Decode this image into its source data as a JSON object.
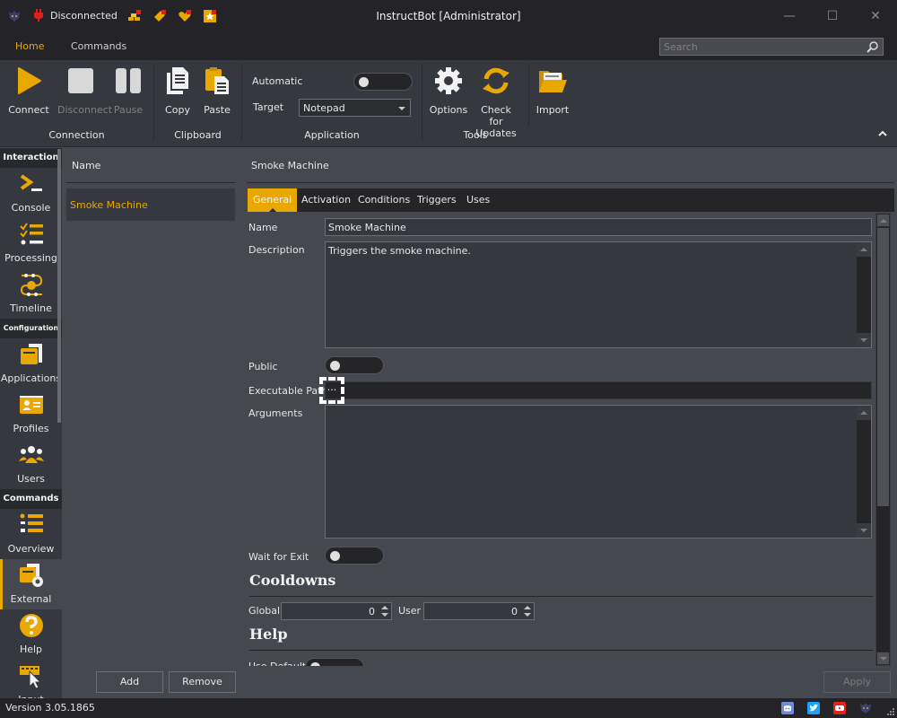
{
  "titlebar": {
    "connection_status": "Disconnected",
    "title": "InstructBot [Administrator]",
    "quick_icons": [
      "gold-bars-icon",
      "ticket-icon",
      "heart-icon",
      "star-icon"
    ],
    "window_controls": {
      "minimize": "—",
      "maximize": "☐",
      "close": "✕"
    }
  },
  "ribbon_tabs": [
    {
      "label": "Home",
      "active": true
    },
    {
      "label": "Commands",
      "active": false
    }
  ],
  "search": {
    "placeholder": "Search",
    "value": ""
  },
  "ribbon": {
    "connection": {
      "label": "Connection",
      "buttons": [
        {
          "label": "Connect",
          "enabled": true
        },
        {
          "label": "Disconnect",
          "enabled": false
        },
        {
          "label": "Pause",
          "enabled": false
        }
      ]
    },
    "clipboard": {
      "label": "Clipboard",
      "buttons": [
        {
          "label": "Copy"
        },
        {
          "label": "Paste"
        }
      ]
    },
    "application": {
      "label": "Application",
      "automatic_label": "Automatic",
      "automatic_on": false,
      "target_label": "Target",
      "target_value": "Notepad"
    },
    "tools": {
      "label": "Tools",
      "buttons": [
        {
          "label": "Options"
        },
        {
          "label": "Check for Updates"
        }
      ]
    },
    "import": {
      "label": "Import"
    }
  },
  "sidebar": {
    "sections": [
      {
        "header": "Interaction",
        "items": [
          {
            "label": "Console"
          },
          {
            "label": "Processing"
          },
          {
            "label": "Timeline"
          }
        ]
      },
      {
        "header": "Configuration",
        "items": [
          {
            "label": "Applications"
          },
          {
            "label": "Profiles"
          },
          {
            "label": "Users"
          }
        ]
      },
      {
        "header": "Commands",
        "items": [
          {
            "label": "Overview"
          },
          {
            "label": "External",
            "active": true
          },
          {
            "label": "Help"
          },
          {
            "label": "Input"
          }
        ]
      }
    ]
  },
  "list": {
    "header": "Name",
    "items": [
      {
        "label": "Smoke Machine",
        "selected": true
      }
    ],
    "add_label": "Add",
    "remove_label": "Remove"
  },
  "detail": {
    "title": "Smoke Machine",
    "tabs": [
      {
        "label": "General",
        "active": true
      },
      {
        "label": "Activation"
      },
      {
        "label": "Conditions"
      },
      {
        "label": "Triggers"
      },
      {
        "label": "Uses"
      }
    ],
    "fields": {
      "name_label": "Name",
      "name_value": "Smoke Machine",
      "description_label": "Description",
      "description_value": "Triggers the smoke machine.",
      "public_label": "Public",
      "public_on": false,
      "exe_label": "Executable Path",
      "exe_value": "",
      "browse_label": "...",
      "arguments_label": "Arguments",
      "arguments_value": "",
      "wait_label": "Wait for Exit",
      "wait_on": false
    },
    "cooldowns": {
      "title": "Cooldowns",
      "global_label": "Global",
      "global_value": "0",
      "user_label": "User",
      "user_value": "0"
    },
    "help": {
      "title": "Help",
      "use_default_label": "Use Default",
      "use_default_on": false
    },
    "apply_label": "Apply"
  },
  "statusbar": {
    "version": "Version 3.05.1865",
    "social_icons": [
      "discord-icon",
      "twitter-icon",
      "youtube-icon",
      "app-logo-icon"
    ]
  },
  "colors": {
    "accent": "#e8a800",
    "background": "#45484f",
    "panel": "#363840",
    "titlebar": "#242428",
    "discord": "#7289da",
    "twitter": "#1da1f2",
    "youtube": "#e62117"
  }
}
